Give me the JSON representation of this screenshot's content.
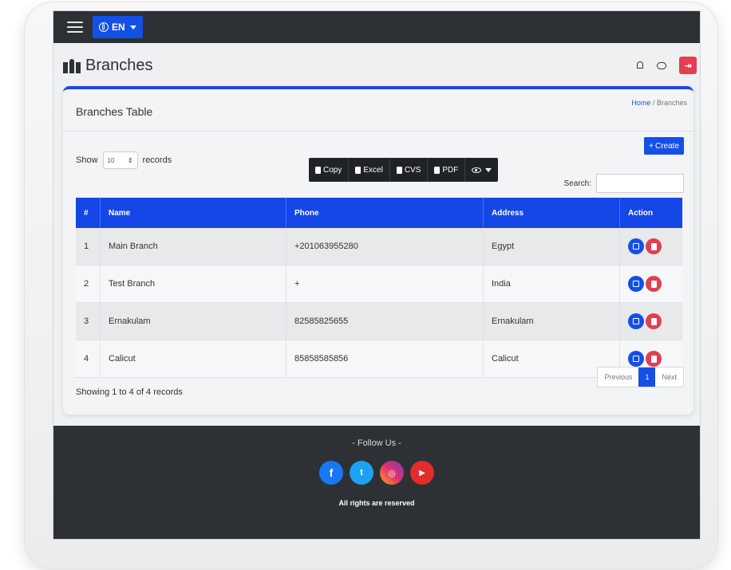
{
  "navbar": {
    "menu_icon": "hamburger-icon",
    "lang_label": "EN"
  },
  "header": {
    "title": "Branches",
    "title_icon": "map-icon",
    "icons": [
      "bell-icon",
      "chat-icon",
      "logout-icon"
    ]
  },
  "card": {
    "title": "Branches Table",
    "breadcrumb": {
      "home": "Home",
      "separator": "/",
      "current": "Branches"
    },
    "create_label": "Create",
    "length": {
      "prefix": "Show",
      "value": "10",
      "suffix": "records"
    },
    "export_buttons": [
      "Copy",
      "Excel",
      "CVS",
      "PDF"
    ],
    "search_label": "Search:",
    "search_value": "",
    "table": {
      "columns": [
        "#",
        "Name",
        "Phone",
        "Address",
        "Action"
      ],
      "rows": [
        {
          "num": "1",
          "name": "Main Branch",
          "phone": "+201063955280",
          "address": "Egypt"
        },
        {
          "num": "2",
          "name": "Test Branch",
          "phone": "+",
          "address": "India"
        },
        {
          "num": "3",
          "name": "Ernakulam",
          "phone": "82585825655",
          "address": "Ernakulam"
        },
        {
          "num": "4",
          "name": "Calicut",
          "phone": "85858585856",
          "address": "Calicut"
        }
      ]
    },
    "info": "Showing 1 to 4 of 4 records",
    "pagination": {
      "previous": "Previous",
      "current": "1",
      "next": "Next"
    }
  },
  "footer": {
    "follow": "- Follow Us -",
    "socials": [
      {
        "name": "facebook",
        "glyph": "f"
      },
      {
        "name": "twitter",
        "glyph": "t"
      },
      {
        "name": "instagram",
        "glyph": "◎"
      },
      {
        "name": "youtube",
        "glyph": "▶"
      }
    ],
    "rights": "All rights are reserved"
  },
  "colors": {
    "primary": "#1450e6",
    "navbar": "#2d3136",
    "danger": "#e0404f"
  }
}
